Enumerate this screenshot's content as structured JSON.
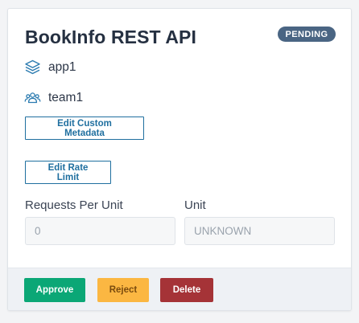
{
  "card": {
    "title": "BookInfo REST API",
    "status": "PENDING",
    "app": {
      "icon": "layers-icon",
      "label": "app1"
    },
    "team": {
      "icon": "team-icon",
      "label": "team1"
    },
    "edit_metadata_label": "Edit Custom Metadata",
    "edit_rate_limit_label": "Edit Rate Limit",
    "requests_per_unit": {
      "label": "Requests Per Unit",
      "value": "0"
    },
    "unit": {
      "label": "Unit",
      "value": "UNKNOWN"
    }
  },
  "actions": {
    "approve_label": "Approve",
    "reject_label": "Reject",
    "delete_label": "Delete"
  },
  "colors": {
    "accent": "#1f6f9f",
    "badge": "#4a6583",
    "approve": "#0ba776",
    "reject": "#fbb742",
    "delete": "#a53337"
  }
}
